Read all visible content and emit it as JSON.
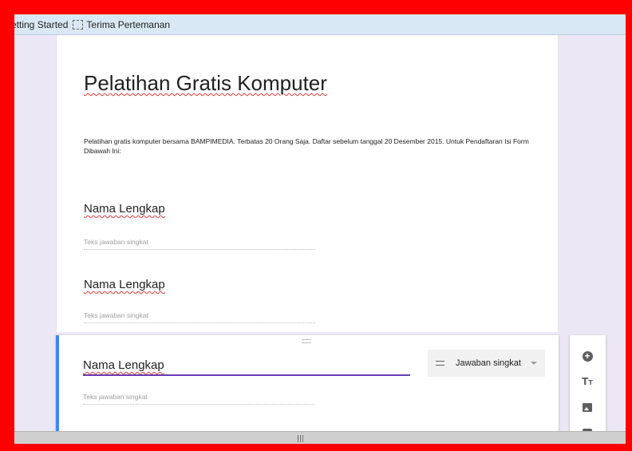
{
  "bookmarks": {
    "items": [
      {
        "label": "etting Started"
      },
      {
        "label": "Terima Pertemanan",
        "icon": "folder-icon"
      }
    ]
  },
  "form": {
    "title": "Pelatihan Gratis Komputer",
    "description": "Pelatihan gratis komputer bersama BAMPIMEDIA. Terbatas 20 Orang Saja. Daftar sebelum tanggal 20 Desember 2015. Untuk Pendaftaran Isi Form Dibawah Ini:",
    "questions": [
      {
        "title": "Nama Lengkap",
        "hint": "Teks jawaban singkat"
      },
      {
        "title": "Nama Lengkap",
        "hint": "Teks jawaban singkat"
      }
    ],
    "active_question": {
      "title": "Nama Lengkap",
      "hint": "Teks jawaban singkat",
      "type_label": "Jawaban singkat",
      "accent_color": "#4285f4",
      "underline_color": "#673ab7"
    }
  },
  "toolbar": {
    "buttons": [
      "add-question-icon",
      "title-text-icon",
      "image-icon",
      "video-icon"
    ],
    "text_glyph": "T",
    "text_glyph_small": "T",
    "add_glyph": "+"
  },
  "scrollbar": {
    "grip": "|||"
  }
}
